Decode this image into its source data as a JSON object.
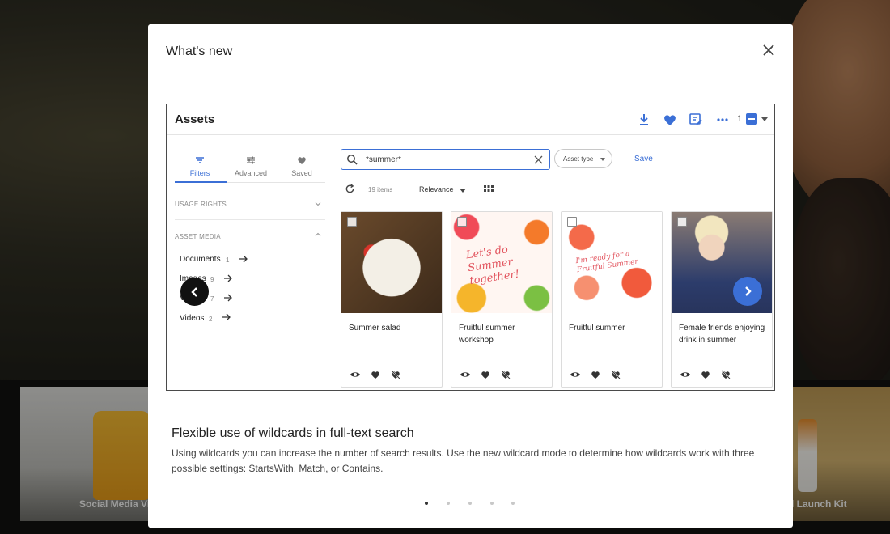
{
  "background": {
    "cards": [
      {
        "label": "Social Media Vi"
      },
      {
        "label": "l Launch Kit"
      }
    ]
  },
  "modal": {
    "title": "What's new",
    "screenshot": {
      "title": "Assets",
      "selection_count": "1",
      "sidebar": {
        "tabs": [
          {
            "label": "Filters",
            "icon": "filter-icon",
            "active": true
          },
          {
            "label": "Advanced",
            "icon": "sliders-icon",
            "active": false
          },
          {
            "label": "Saved",
            "icon": "heart-icon",
            "active": false
          }
        ],
        "sections": [
          {
            "label": "USAGE RIGHTS",
            "expanded": false
          },
          {
            "label": "ASSET MEDIA",
            "expanded": true
          }
        ],
        "media": [
          {
            "label": "Documents",
            "count": "1"
          },
          {
            "label": "Images",
            "count": "9"
          },
          {
            "label": "Videos",
            "count": "7"
          },
          {
            "label": "Videos",
            "count": "2"
          }
        ]
      },
      "search": {
        "value": "*summer*",
        "asset_type_label": "Asset type",
        "save_label": "Save",
        "items_count": "19 items",
        "sort_label": "Relevance"
      },
      "cards": [
        {
          "caption": "Summer salad",
          "image": "salad"
        },
        {
          "caption": "Fruitful summer workshop",
          "image": "workshop"
        },
        {
          "caption": "Fruitful summer",
          "image": "fruitful"
        },
        {
          "caption": "Female friends enjoying drink in summer",
          "image": "friends"
        }
      ],
      "image_text": {
        "workshop": "Let's do Summer together!",
        "fruitful": "I'm ready for a Fruitful Summer"
      }
    },
    "feature": {
      "title": "Flexible use of wildcards in full-text search",
      "description": "Using wildcards you can increase the number of search results. Use the new wildcard mode to determine how wildcards work with three possible settings: StartsWith, Match, or Contains."
    },
    "pagination": {
      "total": 5,
      "active_index": 0
    }
  },
  "colors": {
    "accent": "#3b6fd6",
    "text": "#222222",
    "muted": "#888888"
  }
}
